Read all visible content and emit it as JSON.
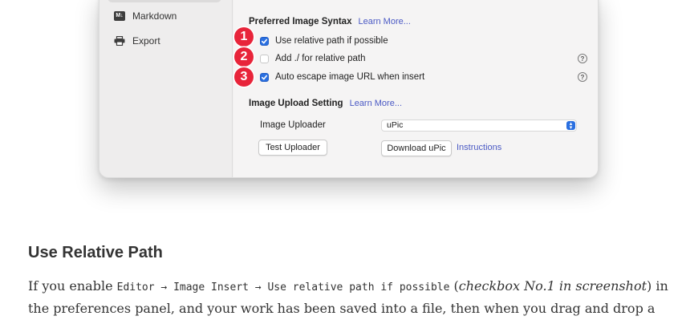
{
  "sidebar": {
    "items": [
      {
        "label": "Markdown",
        "icon": "markdown-icon"
      },
      {
        "label": "Export",
        "icon": "printer-icon"
      }
    ]
  },
  "image_syntax": {
    "title": "Preferred Image Syntax",
    "learn_more": "Learn More...",
    "options": [
      {
        "badge": "1",
        "label": "Use relative path if possible",
        "checked": true,
        "help": false
      },
      {
        "badge": "2",
        "label": "Add ./ for relative path",
        "checked": false,
        "help": true
      },
      {
        "badge": "3",
        "label": "Auto escape image URL when insert",
        "checked": true,
        "help": true
      }
    ],
    "help_glyph": "?"
  },
  "upload": {
    "title": "Image Upload Setting",
    "learn_more": "Learn More...",
    "uploader_label": "Image Uploader",
    "uploader_value": "uPic",
    "test_button": "Test Uploader",
    "download_button": "Download uPic",
    "instructions_link": "Instructions"
  },
  "article": {
    "heading": "Use Relative Path",
    "p_start": "If you enable ",
    "code_path": "Editor → Image Insert → Use relative path if possible",
    "p_paren_open": " (",
    "emphasis": "checkbox No.1 in screenshot",
    "p_rest": ") in the preferences panel, and your work has been saved into a file, then when you drag and drop a local"
  },
  "colors": {
    "accent_blue": "#2a6fe0",
    "link_blue": "#4a59c4",
    "badge_red": "#e8243a"
  }
}
